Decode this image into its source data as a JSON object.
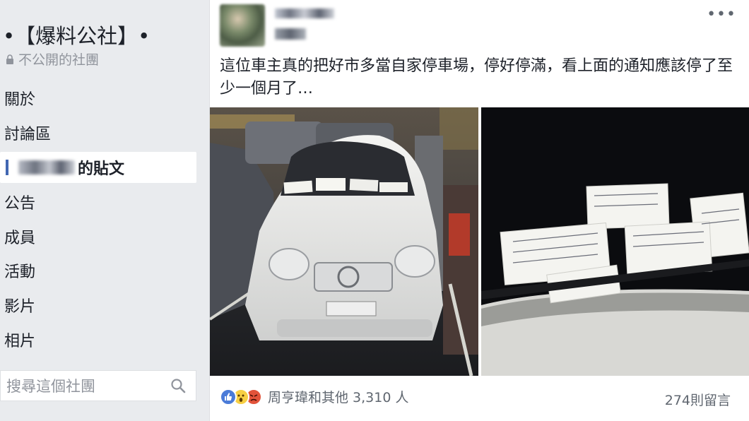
{
  "sidebar": {
    "group_name": "•【爆料公社】•",
    "privacy": "不公開的社團",
    "items": [
      {
        "label": "關於"
      },
      {
        "label": "討論區"
      },
      {
        "label": "的貼文"
      },
      {
        "label": "公告"
      },
      {
        "label": "成員"
      },
      {
        "label": "活動"
      },
      {
        "label": "影片"
      },
      {
        "label": "相片"
      }
    ],
    "search_placeholder": "搜尋這個社團"
  },
  "post": {
    "text": "這位車主真的把好市多當自家停車場，停好停滿，看上面的通知應該停了至少一個月了…",
    "reactions_text": "周亨瑋和其他 3,310 人",
    "comments_text": "274則留言",
    "more_icon": "more-dots-icon"
  },
  "colors": {
    "accent": "#4267b2",
    "like": "#4a7bd8",
    "wow": "#f7cf43",
    "angry": "#e2533a"
  }
}
